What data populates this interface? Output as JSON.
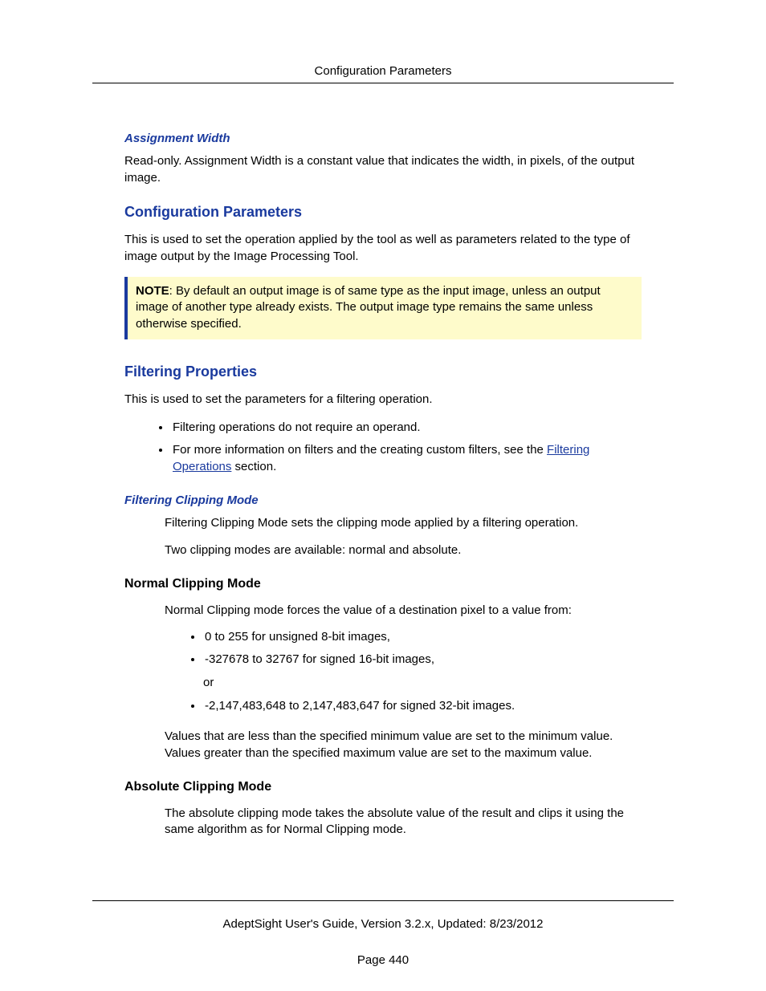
{
  "header": {
    "title": "Configuration Parameters"
  },
  "section1": {
    "heading": "Assignment Width",
    "body": "Read-only. Assignment Width is a constant value that indicates the width, in pixels, of the output image."
  },
  "section2": {
    "heading": "Configuration Parameters",
    "body": "This is used to set the operation applied by the tool as well as parameters related to the type of image output by the Image Processing Tool.",
    "note_label": "NOTE",
    "note_body": ": By default an output image is of same type as the input image, unless an output image of another type already exists. The output image type remains the same unless otherwise specified."
  },
  "section3": {
    "heading": "Filtering Properties",
    "intro": "This is used to set the parameters for a filtering operation.",
    "bullets": {
      "b1": "Filtering operations do not require an operand.",
      "b2_before": "For more information on filters and the creating custom filters, see the ",
      "b2_link": "Filtering Operations",
      "b2_after": " section."
    }
  },
  "section4": {
    "heading": "Filtering Clipping Mode",
    "p1": "Filtering Clipping Mode sets the clipping mode applied by a filtering operation.",
    "p2": "Two clipping modes are available: normal and absolute."
  },
  "section5": {
    "heading": "Normal Clipping Mode",
    "p1": "Normal Clipping mode forces the value of a destination pixel to a value from:",
    "bullets": {
      "b1": "0 to 255 for unsigned 8-bit images,",
      "b2": "-327678 to 32767 for signed 16-bit images,",
      "or": "or",
      "b3": "-2,147,483,648 to 2,147,483,647 for signed 32-bit images."
    },
    "p2": "Values that are less than the specified minimum value are set to the minimum value. Values greater than the specified maximum value are set to the maximum value."
  },
  "section6": {
    "heading": "Absolute Clipping Mode",
    "p1": "The absolute clipping mode takes the absolute value of the result and clips it using the same algorithm as for Normal Clipping mode."
  },
  "footer": {
    "line": "AdeptSight User's Guide,  Version 3.2.x, Updated: 8/23/2012",
    "page": "Page 440"
  }
}
